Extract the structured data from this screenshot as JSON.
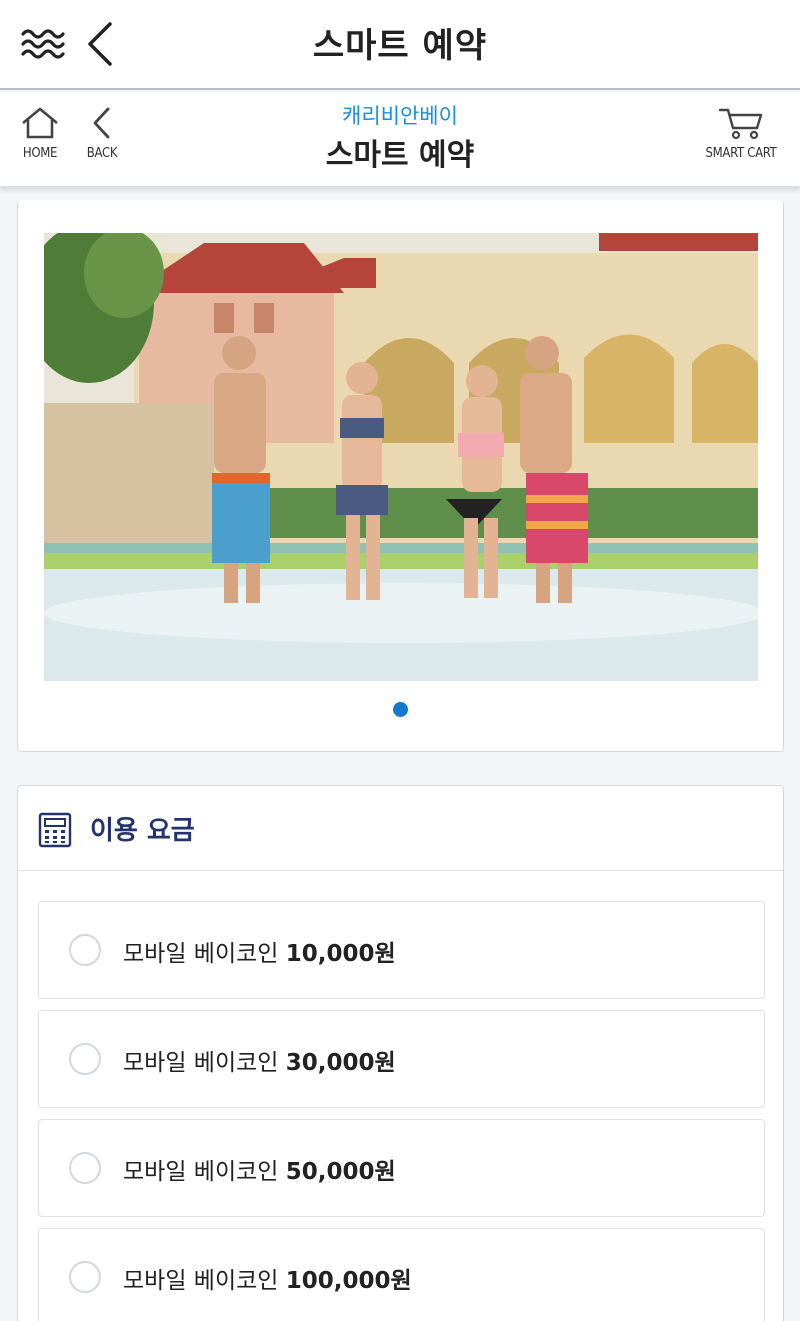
{
  "appbar": {
    "title": "스마트 예약"
  },
  "header": {
    "home_label": "HOME",
    "back_label": "BACK",
    "cart_label": "SMART CART",
    "brand": "캐리비안베이",
    "title": "스마트 예약"
  },
  "slider": {
    "slides": 1,
    "active_index": 0
  },
  "pricing": {
    "title": "이용 요금",
    "options": [
      {
        "name": "모바일 베이코인",
        "amount": "10,000원"
      },
      {
        "name": "모바일 베이코인",
        "amount": "30,000원"
      },
      {
        "name": "모바일 베이코인",
        "amount": "50,000원"
      },
      {
        "name": "모바일 베이코인",
        "amount": "100,000원"
      }
    ]
  },
  "colors": {
    "brand": "#1d8fd8",
    "pricing_title": "#24336c",
    "active_dot": "#1778cf"
  }
}
